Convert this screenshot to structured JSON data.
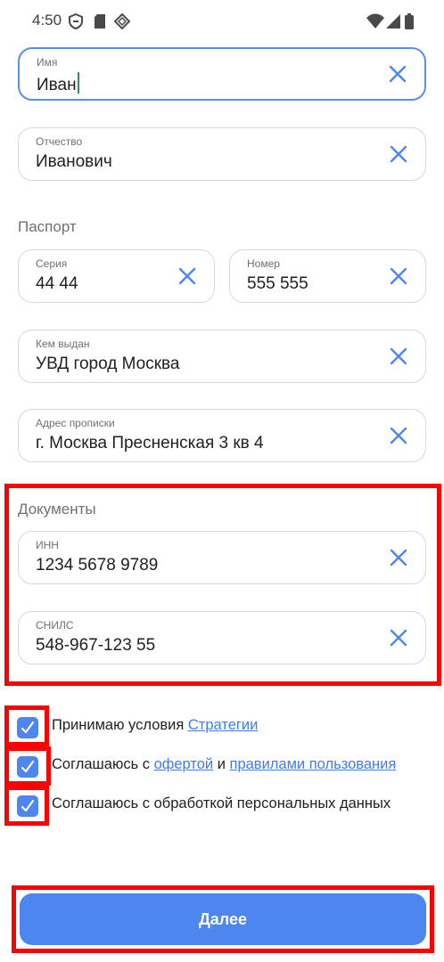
{
  "status_bar": {
    "time": "4:50"
  },
  "fields": {
    "first_name": {
      "label": "Имя",
      "value": "Иван"
    },
    "patronymic": {
      "label": "Отчество",
      "value": "Иванович"
    },
    "passport_series": {
      "label": "Серия",
      "value": "44 44"
    },
    "passport_number": {
      "label": "Номер",
      "value": "555 555"
    },
    "issued_by": {
      "label": "Кем выдан",
      "value": "УВД город Москва"
    },
    "address": {
      "label": "Адрес прописки",
      "value": "г. Москва Пресненская 3 кв 4"
    },
    "inn": {
      "label": "ИНН",
      "value": "1234 5678 9789"
    },
    "snils": {
      "label": "СНИЛС",
      "value": "548-967-123 55"
    }
  },
  "sections": {
    "passport": "Паспорт",
    "documents": "Документы"
  },
  "agreements": {
    "a1": {
      "text1": "Принимаю условия ",
      "link1": "Стратегии",
      "checked": true
    },
    "a2": {
      "text1": "Соглашаюсь с ",
      "link1": "офертой",
      "text2": " и ",
      "link2": "правилами пользования",
      "checked": true
    },
    "a3": {
      "text1": "Соглашаюсь с обработкой персональных данных",
      "checked": true
    }
  },
  "next_button": {
    "label": "Далее"
  },
  "colors": {
    "accent": "#4d86ef",
    "link": "#3f7cf0",
    "highlight": "#ff0000"
  }
}
